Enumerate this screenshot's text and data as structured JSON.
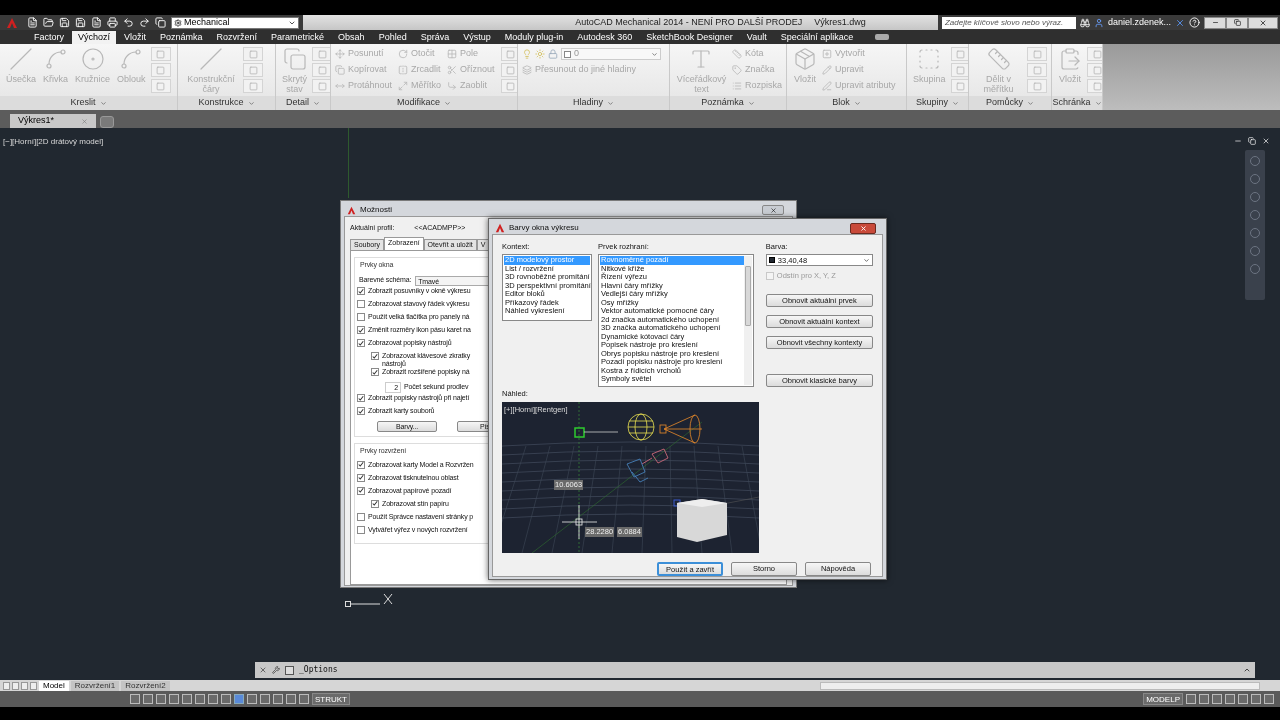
{
  "title_bar": {
    "workspace": "Mechanical",
    "title": "AutoCAD Mechanical 2014 - NENÍ PRO DALŠÍ PRODEJ",
    "file": "Výkres1.dwg",
    "search": {
      "placeholder": "Zadejte klíčové slovo nebo výraz."
    },
    "user": "daniel.zdenek..."
  },
  "ribbon_tabs": [
    {
      "label": "Factory",
      "selected": false
    },
    {
      "label": "Výchozí",
      "selected": true
    },
    {
      "label": "Vložit",
      "selected": false
    },
    {
      "label": "Poznámka",
      "selected": false
    },
    {
      "label": "Rozvržení",
      "selected": false
    },
    {
      "label": "Parametrické",
      "selected": false
    },
    {
      "label": "Obsah",
      "selected": false
    },
    {
      "label": "Pohled",
      "selected": false
    },
    {
      "label": "Správa",
      "selected": false
    },
    {
      "label": "Výstup",
      "selected": false
    },
    {
      "label": "Moduly plug-in",
      "selected": false
    },
    {
      "label": "Autodesk 360",
      "selected": false
    },
    {
      "label": "SketchBook Designer",
      "selected": false
    },
    {
      "label": "Vault",
      "selected": false
    },
    {
      "label": "Speciální aplikace",
      "selected": false
    }
  ],
  "ribbon_panels": [
    {
      "title": "Kreslit",
      "tools": [
        {
          "kind": "large",
          "label": "Úsečka"
        },
        {
          "kind": "large",
          "label": "Křivka"
        },
        {
          "kind": "large",
          "label": "Kružnice"
        },
        {
          "kind": "large",
          "label": "Oblouk"
        },
        {
          "kind": "icon"
        },
        {
          "kind": "icon"
        },
        {
          "kind": "icon"
        }
      ]
    },
    {
      "title": "Konstrukce",
      "tools": [
        {
          "kind": "large",
          "label": "Konstrukční čáry"
        },
        {
          "kind": "icon"
        },
        {
          "kind": "icon"
        },
        {
          "kind": "icon"
        }
      ]
    },
    {
      "title": "Detail",
      "tools": [
        {
          "kind": "large",
          "label": "Skrytý stav"
        },
        {
          "kind": "icon"
        },
        {
          "kind": "icon"
        },
        {
          "kind": "icon"
        }
      ]
    },
    {
      "title": "Modifikace",
      "tools": [
        {
          "kind": "small",
          "label": "Posunutí"
        },
        {
          "kind": "small",
          "label": "Kopírovat"
        },
        {
          "kind": "small",
          "label": "Protáhnout"
        },
        {
          "kind": "small",
          "label": "Otočit"
        },
        {
          "kind": "small",
          "label": "Zrcadlit"
        },
        {
          "kind": "small",
          "label": "Měřítko"
        },
        {
          "kind": "small",
          "label": "Pole"
        },
        {
          "kind": "small",
          "label": "Oříznout"
        },
        {
          "kind": "small",
          "label": "Zaoblit"
        },
        {
          "kind": "icon"
        },
        {
          "kind": "icon"
        },
        {
          "kind": "icon"
        }
      ]
    },
    {
      "title": "Hladiny",
      "tools": [
        {
          "kind": "combo",
          "label": "0"
        },
        {
          "kind": "small",
          "label": "Přesunout do jiné hladiny"
        }
      ]
    },
    {
      "title": "Poznámka",
      "tools": [
        {
          "kind": "large",
          "label": "Víceřádkový text"
        },
        {
          "kind": "small",
          "label": "Kóta"
        },
        {
          "kind": "small",
          "label": "Značka"
        },
        {
          "kind": "small",
          "label": "Rozpiska"
        }
      ]
    },
    {
      "title": "Blok",
      "tools": [
        {
          "kind": "large",
          "label": "Vložit"
        },
        {
          "kind": "small",
          "label": "Vytvořit"
        },
        {
          "kind": "small",
          "label": "Upravit"
        },
        {
          "kind": "small",
          "label": "Upravit atributy"
        }
      ]
    },
    {
      "title": "Skupiny",
      "tools": [
        {
          "kind": "large",
          "label": "Skupina"
        },
        {
          "kind": "icon"
        },
        {
          "kind": "icon"
        },
        {
          "kind": "icon"
        }
      ]
    },
    {
      "title": "Pomůcky",
      "tools": [
        {
          "kind": "large",
          "label": "Dělit v měřítku"
        },
        {
          "kind": "icon"
        },
        {
          "kind": "icon"
        },
        {
          "kind": "icon"
        }
      ]
    },
    {
      "title": "Schránka",
      "tools": [
        {
          "kind": "large",
          "label": "Vložit"
        },
        {
          "kind": "icon"
        },
        {
          "kind": "icon"
        },
        {
          "kind": "icon"
        }
      ]
    }
  ],
  "file_tabs": [
    {
      "label": "Výkres1*",
      "selected": true
    }
  ],
  "viewport_label": "[−][Horní][2D drátový model]",
  "options_dialog": {
    "title": "Možnosti",
    "profile_label": "Aktuální profil:",
    "profile": "<<ACADMPP>>",
    "tabs": [
      {
        "label": "Soubory",
        "selected": false
      },
      {
        "label": "Zobrazení",
        "selected": true
      },
      {
        "label": "Otevřít a uložit",
        "selected": false
      },
      {
        "label": "V",
        "selected": false
      }
    ],
    "window_group": {
      "title": "Prvky okna",
      "scheme_label": "Barevné schéma:",
      "scheme": "Tmavé",
      "items": [
        {
          "kind": "check",
          "label": "Zobrazit posuvníky v okně výkresu",
          "checked": true
        },
        {
          "kind": "check",
          "label": "Zobrazovat stavový řádek výkresu",
          "checked": false
        },
        {
          "kind": "check",
          "label": "Použít velká tlačítka pro panely ná",
          "checked": false
        },
        {
          "kind": "check",
          "label": "Změnit rozměry ikon pásu karet na",
          "checked": true
        },
        {
          "kind": "check",
          "label": "Zobrazovat popisky nástrojů",
          "checked": true
        },
        {
          "kind": "subcheck",
          "label": "Zobrazovat klávesové zkratky nástrojů",
          "checked": true
        },
        {
          "kind": "subcheck",
          "label": "Zobrazit rozšířené popisky ná",
          "checked": true
        },
        {
          "kind": "number",
          "value": "2",
          "label": "Počet sekund prodlev"
        },
        {
          "kind": "check",
          "label": "Zobrazit popisky nástrojů při najetí",
          "checked": true
        },
        {
          "kind": "check",
          "label": "Zobrazit karty souborů",
          "checked": true
        }
      ],
      "buttons": [
        "Barvy...",
        "Pís"
      ]
    },
    "layout_group": {
      "title": "Prvky rozvržení",
      "items": [
        {
          "kind": "check",
          "label": "Zobrazovat karty Model a Rozvržen",
          "checked": true
        },
        {
          "kind": "check",
          "label": "Zobrazovat tisknutelnou oblast",
          "checked": true
        },
        {
          "kind": "check",
          "label": "Zobrazovat papírové pozadí",
          "checked": true
        },
        {
          "kind": "subcheck",
          "label": "Zobrazovat stín papíru",
          "checked": true
        },
        {
          "kind": "check",
          "label": "Použít Správce nastavení stránky p",
          "checked": false
        },
        {
          "kind": "check",
          "label": "Vytvářet výřez v nových rozvržení",
          "checked": false
        }
      ]
    }
  },
  "colors_dialog": {
    "title": "Barvy okna výkresu",
    "context_label": "Kontext:",
    "contexts": [
      {
        "label": "2D modelový prostor",
        "selected": true
      },
      {
        "label": "List / rozvržení",
        "selected": false
      },
      {
        "label": "3D rovnoběžné promítání",
        "selected": false
      },
      {
        "label": "3D perspektivní promítání",
        "selected": false
      },
      {
        "label": "Editor bloků",
        "selected": false
      },
      {
        "label": "Příkazový řádek",
        "selected": false
      },
      {
        "label": "Náhled vykreslení",
        "selected": false
      }
    ],
    "element_label": "Prvek rozhraní:",
    "elements": [
      {
        "label": "Rovnoměrné pozadí",
        "selected": true
      },
      {
        "label": "Nitkové kříže",
        "selected": false
      },
      {
        "label": "Řízení výřezu",
        "selected": false
      },
      {
        "label": "Hlavní čáry mřížky",
        "selected": false
      },
      {
        "label": "Vedlejší čáry mřížky",
        "selected": false
      },
      {
        "label": "Osy mřížky",
        "selected": false
      },
      {
        "label": "Vektor automatické pomocné čáry",
        "selected": false
      },
      {
        "label": "2d značka automatického uchopení",
        "selected": false
      },
      {
        "label": "3D značka automatického uchopení",
        "selected": false
      },
      {
        "label": "Dynamické kótovací čáry",
        "selected": false
      },
      {
        "label": "Popisek nástroje pro kreslení",
        "selected": false
      },
      {
        "label": "Obrys popisku nástroje pro kreslení",
        "selected": false
      },
      {
        "label": "Pozadí popisku nástroje pro kreslení",
        "selected": false
      },
      {
        "label": "Kostra z řídicích vrcholů",
        "selected": false
      },
      {
        "label": "Symboly světel",
        "selected": false
      }
    ],
    "color_label": "Barva:",
    "color": {
      "label": "33,40,48",
      "color": "#212830"
    },
    "tint": {
      "label": "Odstín pro X, Y, Z",
      "checked": false,
      "disabled": true
    },
    "reset_buttons": [
      "Obnovit aktuální prvek",
      "Obnovit aktuální kontext",
      "Obnovit všechny kontexty",
      "Obnovit klasické barvy"
    ],
    "preview_label": "Náhled:",
    "preview": {
      "caption": "[+][Horní][Rentgen]",
      "values": [
        "10.6063",
        "28.2280",
        "6.0884"
      ]
    },
    "buttons": [
      {
        "label": "Použít a zavřít",
        "default": true
      },
      {
        "label": "Storno",
        "default": false
      },
      {
        "label": "Nápověda",
        "default": false
      }
    ]
  },
  "command_line": {
    "text": "_Options"
  },
  "layout_tabs": [
    {
      "label": "Model",
      "selected": true
    },
    {
      "label": "Rozvržení1",
      "selected": false
    },
    {
      "label": "Rozvržení2",
      "selected": false
    }
  ],
  "status_bar": {
    "struct": "STRUKT",
    "space": "MODELP"
  }
}
